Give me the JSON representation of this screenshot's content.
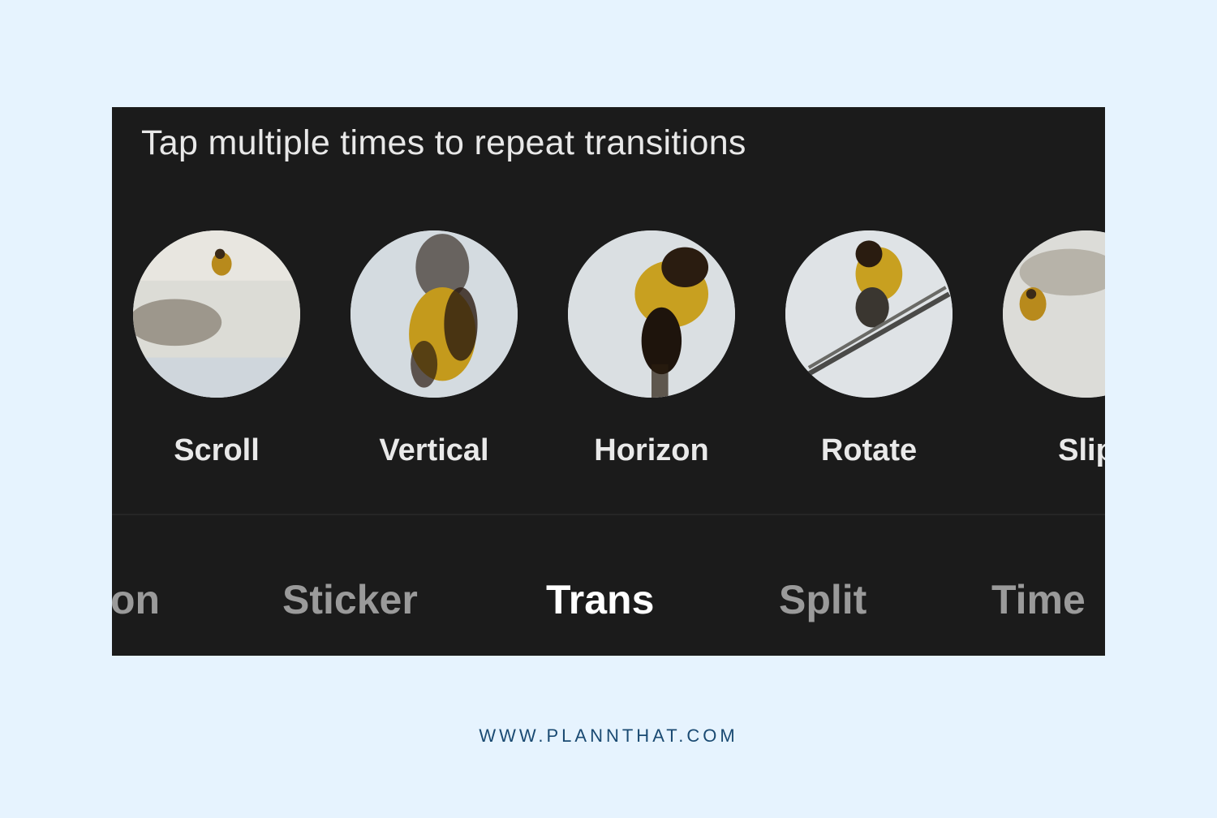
{
  "panel": {
    "hint": "Tap multiple times to repeat transitions",
    "transitions": [
      {
        "label": "Scroll"
      },
      {
        "label": "Vertical"
      },
      {
        "label": "Horizon"
      },
      {
        "label": "Rotate"
      },
      {
        "label": "Slip"
      }
    ],
    "tabs": [
      {
        "label": "on",
        "active": false
      },
      {
        "label": "Sticker",
        "active": false
      },
      {
        "label": "Trans",
        "active": true
      },
      {
        "label": "Split",
        "active": false
      },
      {
        "label": "Time",
        "active": false
      }
    ]
  },
  "footer": {
    "url": "WWW.PLANNTHAT.COM"
  }
}
